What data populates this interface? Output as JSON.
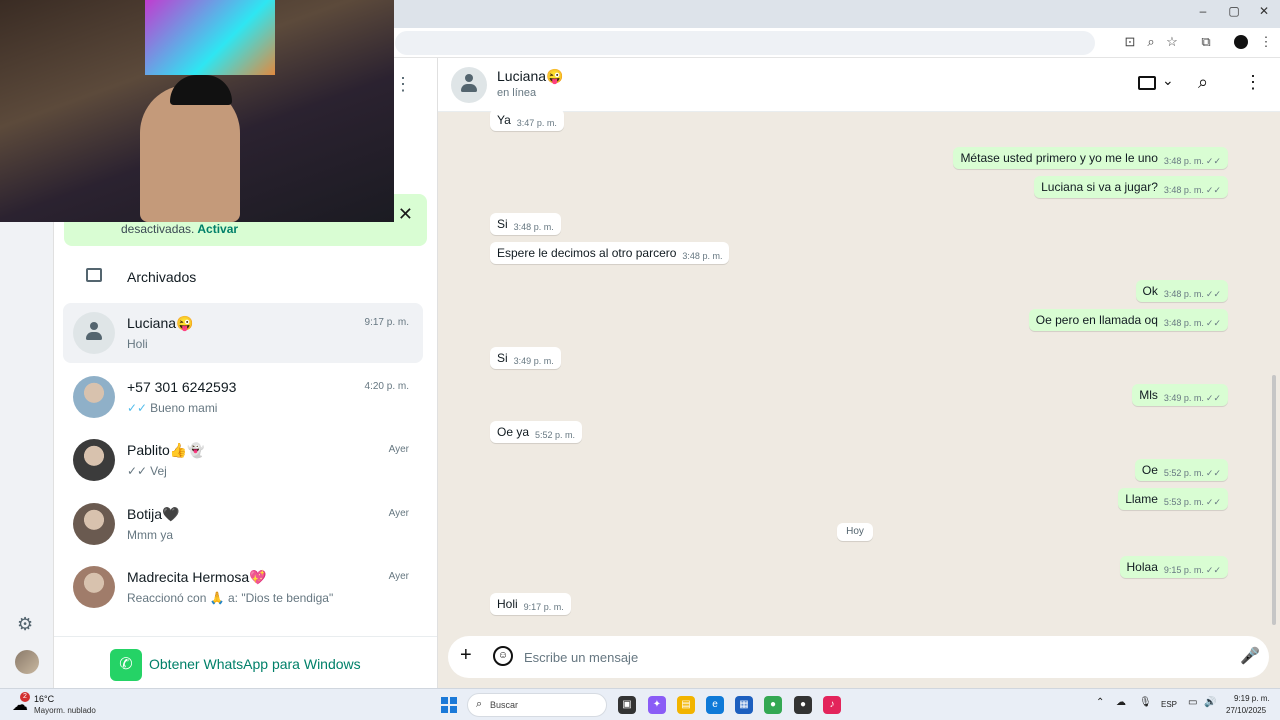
{
  "browser": {
    "window_controls": {
      "minimize": "–",
      "maximize": "▢",
      "close": "✕"
    }
  },
  "sidebar": {
    "notice": {
      "text": "desactivadas.",
      "action": "Activar"
    },
    "archived_label": "Archivados",
    "chats": [
      {
        "name": "Luciana😜",
        "time": "9:17 p. m.",
        "preview": "Holi",
        "ticks": "",
        "avatar": "default",
        "active": true
      },
      {
        "name": "+57 301 6242593",
        "time": "4:20 p. m.",
        "preview": "Bueno mami",
        "ticks": "✓✓",
        "ticks_color": "#53bdeb",
        "avatar": "photo"
      },
      {
        "name": "Pablito👍👻",
        "time": "Ayer",
        "preview": "Vej",
        "ticks": "✓✓",
        "ticks_color": "#667781",
        "avatar": "photo"
      },
      {
        "name": "Botija🖤",
        "time": "Ayer",
        "preview": "Mmm ya",
        "ticks": "",
        "avatar": "photo"
      },
      {
        "name": "Madrecita Hermosa💖",
        "time": "Ayer",
        "preview": "Reaccionó con 🙏 a: \"Dios te bendiga\"",
        "ticks": "",
        "avatar": "photo"
      }
    ],
    "get_app_label": "Obtener WhatsApp para Windows"
  },
  "chat": {
    "contact_name": "Luciana😜",
    "status": "en línea",
    "day_separator": "Hoy",
    "messages": [
      {
        "dir": "in",
        "text": "Ya",
        "time": "3:47 p. m."
      },
      {
        "dir": "out",
        "text": "Métase usted primero y yo me le uno",
        "time": "3:48 p. m."
      },
      {
        "dir": "out",
        "text": "Luciana si va a jugar?",
        "time": "3:48 p. m."
      },
      {
        "dir": "in",
        "text": "Si",
        "time": "3:48 p. m."
      },
      {
        "dir": "in",
        "text": "Espere le decimos al otro parcero",
        "time": "3:48 p. m."
      },
      {
        "dir": "out",
        "text": "Ok",
        "time": "3:48 p. m."
      },
      {
        "dir": "out",
        "text": "Oe pero en llamada oq",
        "time": "3:48 p. m."
      },
      {
        "dir": "in",
        "text": "Si",
        "time": "3:49 p. m."
      },
      {
        "dir": "out",
        "text": "Mls",
        "time": "3:49 p. m."
      },
      {
        "dir": "in",
        "text": "Oe ya",
        "time": "5:52 p. m."
      },
      {
        "dir": "out",
        "text": "Oe",
        "time": "5:52 p. m."
      },
      {
        "dir": "out",
        "text": "Llame",
        "time": "5:53 p. m."
      },
      {
        "dir": "out",
        "text": "Holaa",
        "time": "9:15 p. m."
      },
      {
        "dir": "in",
        "text": "Holi",
        "time": "9:17 p. m."
      }
    ],
    "read_ticks": "✓✓",
    "composer_placeholder": "Escribe un mensaje"
  },
  "taskbar": {
    "weather_badge": "2",
    "weather_temp": "16°C",
    "weather_condition": "Mayorm. nublado",
    "search_label": "Buscar",
    "language": "ESP",
    "time": "9:19 p. m.",
    "date": "27/10/2025"
  },
  "colors": {
    "accent": "#008069",
    "outgoing_bubble": "#d9fdd3",
    "chat_bg": "#efeae2",
    "read_tick": "#53bdeb"
  }
}
